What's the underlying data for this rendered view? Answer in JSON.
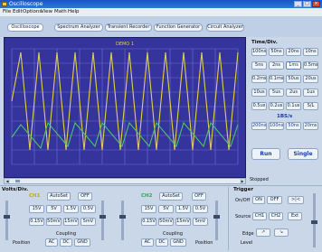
{
  "window": {
    "title": "Oscilloscope"
  },
  "menu": [
    "File",
    "Edit",
    "Options",
    "View",
    "Math",
    "Help"
  ],
  "tabs": [
    "Oscilloscope",
    "Spectrum Analyzer",
    "Transient Recorder",
    "Function Generator",
    "Circuit Analyzer"
  ],
  "screen": {
    "top_label": "DEMO 1"
  },
  "time_div": {
    "title": "Time/Div.",
    "buttons": [
      [
        "100ns",
        "50ns",
        "20ns",
        "10ns"
      ],
      [
        "5ns",
        "2ns",
        "1ms",
        "0.5ms"
      ],
      [
        "0.2ms",
        "0.1ms",
        "50us",
        "20us"
      ],
      [
        "10us",
        "5us",
        "2us",
        "1us"
      ],
      [
        "0.5us",
        "0.2us",
        "0.1us",
        "S/L"
      ]
    ],
    "selected": "1ms",
    "rate_label": "1BS/s",
    "rate_buttons": [
      "200ns",
      "100ns",
      "50ns",
      "20ms"
    ]
  },
  "run_label": "Run",
  "single_label": "Single",
  "status": "Stopped",
  "volts_div": {
    "title": "Volts/Div.",
    "ch1": {
      "label": "CH1",
      "autoset": "AutoSet",
      "off": "OFF",
      "row1": [
        "15V",
        "5V",
        "1.5V",
        "0.5V"
      ],
      "row2": [
        "0.15V",
        "50mV",
        "15mV",
        "5mV"
      ],
      "coupling_label": "Coupling",
      "position_label": "Position",
      "coupling": [
        "AC",
        "DC",
        "GND"
      ]
    },
    "ch2": {
      "label": "CH2",
      "autoset": "AutoSet",
      "off": "OFF",
      "row1": [
        "15V",
        "5V",
        "1.5V",
        "0.5V"
      ],
      "row2": [
        "0.15V",
        "50mV",
        "15mV",
        "5mV"
      ],
      "coupling_label": "Coupling",
      "position_label": "Position",
      "coupling": [
        "AC",
        "DC",
        "GND"
      ]
    }
  },
  "trigger": {
    "title": "Trigger",
    "onoff_label": "On/Off",
    "on": "ON",
    "off": "OFF",
    "source_label": "Source",
    "sources": [
      "CH1",
      "CH2",
      "Ext"
    ],
    "edge_label": "Edge",
    "level_label": "Level"
  },
  "colors": {
    "ch1": "#e2cf4a",
    "ch2": "#49c46a",
    "screen_bg": "#34349c",
    "grid": "#6f6fd6"
  }
}
